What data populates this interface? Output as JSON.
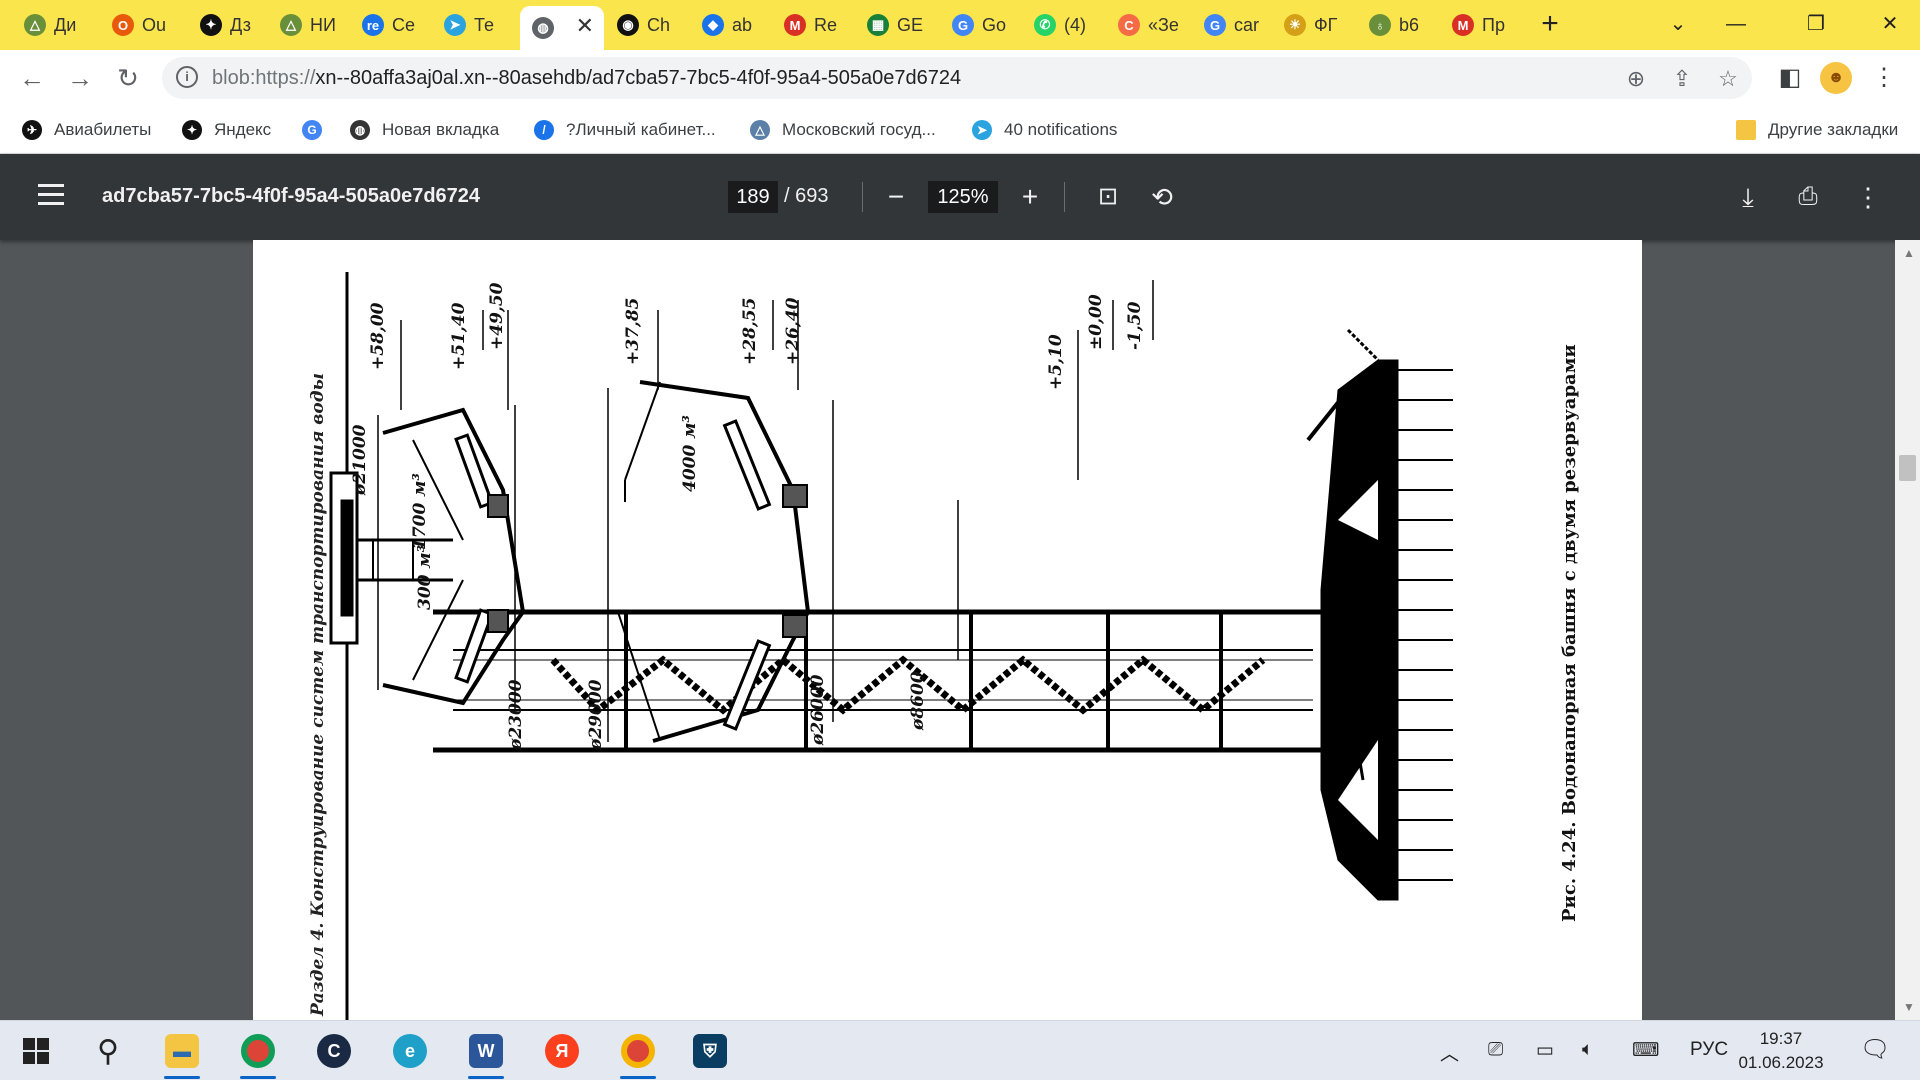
{
  "tabs": [
    {
      "label": "Ди",
      "color": "#6a8f3a",
      "glyph": "△"
    },
    {
      "label": "Ou",
      "color": "#e8590c",
      "glyph": "O"
    },
    {
      "label": "Дз",
      "color": "#111111",
      "glyph": "✦"
    },
    {
      "label": "НИ",
      "color": "#6a8f3a",
      "glyph": "△"
    },
    {
      "label": "Се",
      "color": "#1a73e8",
      "glyph": "re"
    },
    {
      "label": "Те",
      "color": "#2aa3df",
      "glyph": "➤"
    },
    {
      "label": "",
      "color": "#5f6368",
      "glyph": "◍",
      "active": true
    },
    {
      "label": "Ch",
      "color": "#111111",
      "glyph": "◉"
    },
    {
      "label": "ab",
      "color": "#1a73e8",
      "glyph": "◆"
    },
    {
      "label": "Re",
      "color": "#d93025",
      "glyph": "M"
    },
    {
      "label": "GE",
      "color": "#188038",
      "glyph": "▦"
    },
    {
      "label": "Go",
      "color": "#4285f4",
      "glyph": "G"
    },
    {
      "label": "(4)",
      "color": "#25d366",
      "glyph": "✆"
    },
    {
      "label": "«Зе",
      "color": "#f46b45",
      "glyph": "C"
    },
    {
      "label": "car",
      "color": "#4285f4",
      "glyph": "G"
    },
    {
      "label": "ФГ",
      "color": "#d4a017",
      "glyph": "☀"
    },
    {
      "label": "b6",
      "color": "#6a8f3a",
      "glyph": "♁"
    },
    {
      "label": "Пр",
      "color": "#d93025",
      "glyph": "M"
    }
  ],
  "window": {
    "minimize": "—",
    "maximize": "❐",
    "close": "✕",
    "tabsearch": "⌄",
    "newtab": "+"
  },
  "address": {
    "scheme": "blob:https://",
    "rest": "xn--80affa3aj0al.xn--80asehdb/ad7cba57-7bc5-4f0f-95a4-505a0e7d6724"
  },
  "bookmarks": [
    {
      "label": "Авиабилеты",
      "color": "#111111",
      "glyph": "✈"
    },
    {
      "label": "Яндекс",
      "color": "#111111",
      "glyph": "✦"
    },
    {
      "label": "",
      "color": "#4285f4",
      "glyph": "G"
    },
    {
      "label": "Новая вкладка",
      "color": "#333333",
      "glyph": "◍"
    },
    {
      "label": "?Личный кабинет...",
      "color": "#1a73e8",
      "glyph": "/"
    },
    {
      "label": "Московский госуд...",
      "color": "#5b7fa6",
      "glyph": "△"
    },
    {
      "label": "40 notifications",
      "color": "#2aa3df",
      "glyph": "➤"
    }
  ],
  "other_bookmarks": "Другие закладки",
  "pdf": {
    "title": "ad7cba57-7bc5-4f0f-95a4-505a0e7d6724",
    "page": "189",
    "total": "/ 693",
    "zoom": "125%"
  },
  "drawing": {
    "section_caption": "Раздел 4. Конструирование систем транспортирования воды",
    "figure_caption": "Рис. 4.24. Водонапорная башня с двумя резервуарами",
    "elevations": [
      "+58,00",
      "+51,40",
      "+49,50",
      "+37,85",
      "+28,55",
      "+26,40",
      "+5,10",
      "±0,00",
      "-1,50"
    ],
    "diameters": [
      "ø21000",
      "ø23000",
      "ø29000",
      "ø26000",
      "ø8600"
    ],
    "volumes": [
      "1700 м³",
      "300 м³",
      "4000 м³"
    ]
  },
  "taskbar": {
    "tray_lang": "РУС",
    "time": "19:37",
    "date": "01.06.2023"
  }
}
